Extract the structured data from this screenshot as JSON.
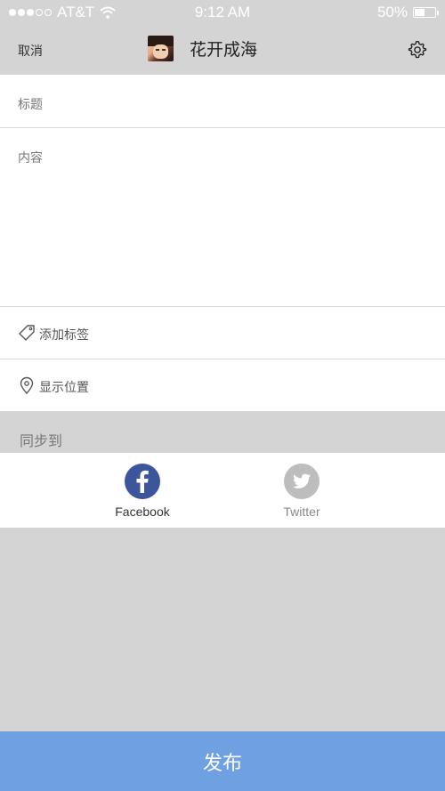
{
  "status_bar": {
    "signal_dots": "●●●○○",
    "carrier": "AT&T",
    "time": "9:12 AM",
    "battery_percent": "50%",
    "battery_level": 0.5,
    "icons": [
      "signal-dots-icon",
      "wifi-icon",
      "battery-icon"
    ]
  },
  "nav": {
    "cancel_label": "取消",
    "title": "花开成海",
    "settings_icon": "gear-icon"
  },
  "form": {
    "title_placeholder": "标题",
    "content_placeholder": "内容",
    "tag_label": "添加标签",
    "tag_icon": "tag-icon",
    "location_label": "显示位置",
    "location_icon": "location-pin-icon"
  },
  "sync": {
    "header": "同步到",
    "services": [
      {
        "label": "Facebook",
        "icon": "facebook-icon",
        "color": "#3d569b",
        "active": true
      },
      {
        "label": "Twitter",
        "icon": "twitter-icon",
        "color": "#bdbdbd",
        "active": false
      }
    ]
  },
  "publish_label": "发布",
  "colors": {
    "background": "#d4d4d4",
    "publish": "#6fa1e2",
    "facebook": "#3d569b",
    "twitter_inactive": "#bdbdbd"
  }
}
